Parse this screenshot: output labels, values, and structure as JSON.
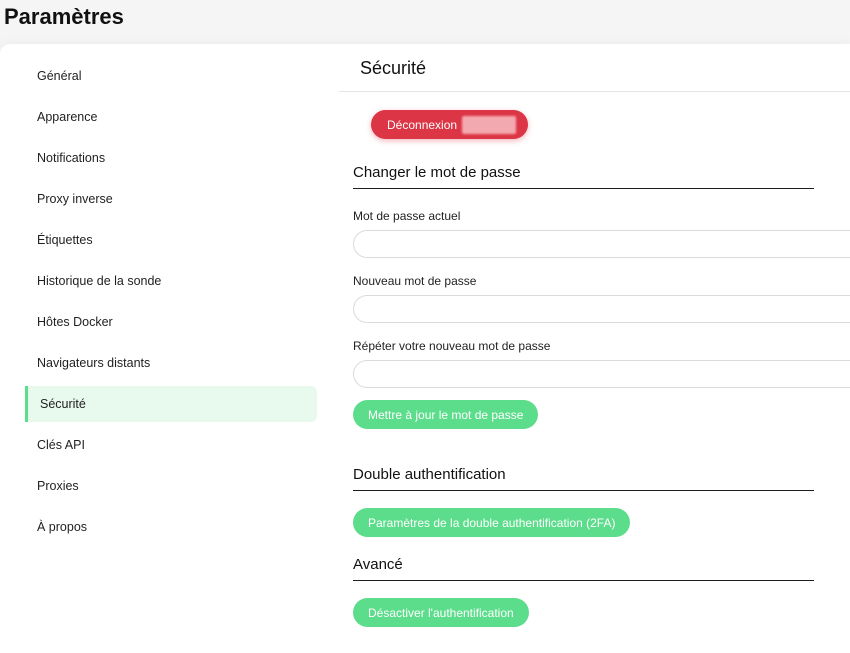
{
  "page": {
    "title": "Paramètres"
  },
  "sidebar": {
    "items": [
      {
        "label": "Général"
      },
      {
        "label": "Apparence"
      },
      {
        "label": "Notifications"
      },
      {
        "label": "Proxy inverse"
      },
      {
        "label": "Étiquettes"
      },
      {
        "label": "Historique de la sonde"
      },
      {
        "label": "Hôtes Docker"
      },
      {
        "label": "Navigateurs distants"
      },
      {
        "label": "Sécurité"
      },
      {
        "label": "Clés API"
      },
      {
        "label": "Proxies"
      },
      {
        "label": "À propos"
      }
    ],
    "active": "Sécurité"
  },
  "security": {
    "title": "Sécurité",
    "logout_label": "Déconnexion",
    "change_password": {
      "heading": "Changer le mot de passe",
      "current_label": "Mot de passe actuel",
      "current_value": "",
      "new_label": "Nouveau mot de passe",
      "new_value": "",
      "repeat_label": "Répéter votre nouveau mot de passe",
      "repeat_value": "",
      "submit_label": "Mettre à jour le mot de passe"
    },
    "two_factor": {
      "heading": "Double authentification",
      "button_label": "Paramètres de la double authentification (2FA)"
    },
    "advanced": {
      "heading": "Avancé",
      "button_label": "Désactiver l'authentification"
    }
  },
  "colors": {
    "accent": "#5cdd8b",
    "danger": "#dc3545",
    "active_bg": "#e8faee"
  }
}
